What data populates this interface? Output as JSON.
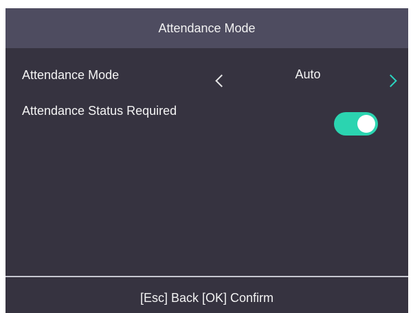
{
  "header": {
    "title": "Attendance Mode"
  },
  "settings": {
    "attendance_mode": {
      "label": "Attendance Mode",
      "value": "Auto"
    },
    "attendance_status_required": {
      "label": "Attendance Status Required",
      "enabled": true
    }
  },
  "footer": {
    "hint": "[Esc] Back [OK] Confirm"
  },
  "icons": {
    "prev": "chevron-left-icon",
    "next": "chevron-right-icon"
  },
  "colors": {
    "background": "#363340",
    "title_bar": "#4e4c60",
    "accent": "#2bd4b0",
    "text": "#f4f4f4"
  }
}
